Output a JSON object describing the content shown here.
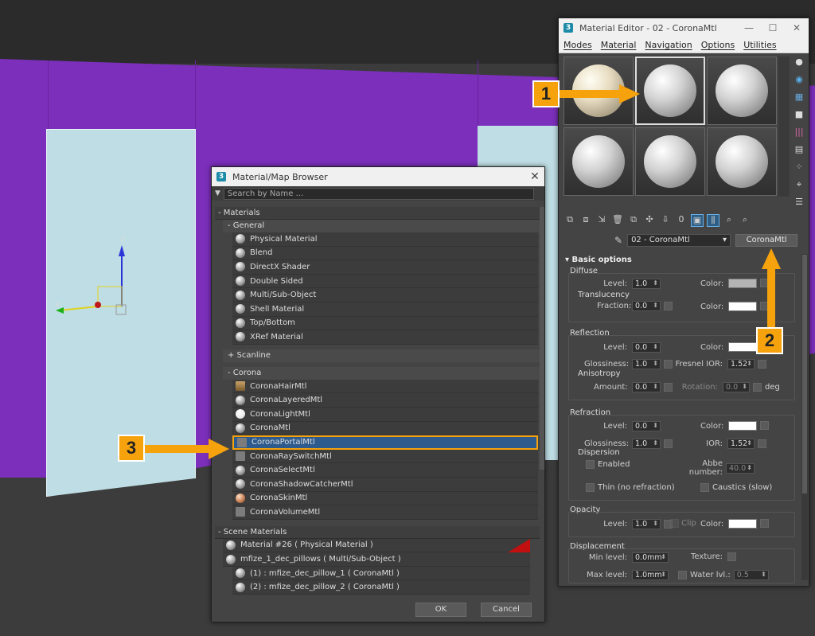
{
  "material_editor": {
    "title": "Material Editor - 02 - CoronaMtl",
    "menu": [
      "Modes",
      "Material",
      "Navigation",
      "Options",
      "Utilities"
    ],
    "material_name": "02 - CoronaMtl",
    "material_type": "CoronaMtl",
    "rollout_title": "Basic options",
    "diffuse": {
      "title": "Diffuse",
      "level_label": "Level:",
      "level": "1.0",
      "color_label": "Color:",
      "color": "#b4b4b4",
      "translucency_title": "Translucency",
      "fraction_label": "Fraction:",
      "fraction": "0.0",
      "trans_color_label": "Color:",
      "trans_color": "#ffffff"
    },
    "reflection": {
      "title": "Reflection",
      "level_label": "Level:",
      "level": "0.0",
      "color_label": "Color:",
      "color": "#ffffff",
      "glossiness_label": "Glossiness:",
      "glossiness": "1.0",
      "ior_label": "Fresnel IOR:",
      "ior": "1.52",
      "anisotropy_title": "Anisotropy",
      "amount_label": "Amount:",
      "amount": "0.0",
      "rotation_label": "Rotation:",
      "rotation": "0.0",
      "rotation_unit": "deg"
    },
    "refraction": {
      "title": "Refraction",
      "level_label": "Level:",
      "level": "0.0",
      "color_label": "Color:",
      "color": "#ffffff",
      "glossiness_label": "Glossiness:",
      "glossiness": "1.0",
      "ior_label": "IOR:",
      "ior": "1.52",
      "dispersion_title": "Dispersion",
      "enabled_label": "Enabled",
      "abbe_label": "Abbe number:",
      "abbe": "40.0",
      "thin_label": "Thin (no refraction)",
      "caustics_label": "Caustics (slow)"
    },
    "opacity": {
      "title": "Opacity",
      "level_label": "Level:",
      "level": "1.0",
      "clip_label": "Clip",
      "color_label": "Color:",
      "color": "#ffffff"
    },
    "displacement": {
      "title": "Displacement",
      "min_label": "Min level:",
      "min": "0.0mm",
      "texture_label": "Texture:",
      "max_label": "Max level:",
      "max": "1.0mm",
      "water_label": "Water lvl.:",
      "water": "0.5"
    }
  },
  "browser": {
    "title": "Material/Map Browser",
    "search_placeholder": "Search by Name ...",
    "materials_header": "- Materials",
    "general_header": "- General",
    "general_items": [
      "Physical Material",
      "Blend",
      "DirectX Shader",
      "Double Sided",
      "Multi/Sub-Object",
      "Shell Material",
      "Top/Bottom",
      "XRef Material"
    ],
    "scanline_header": "+ Scanline",
    "corona_header": "- Corona",
    "corona_items": [
      "CoronaHairMtl",
      "CoronaLayeredMtl",
      "CoronaLightMtl",
      "CoronaMtl",
      "CoronaPortalMtl",
      "CoronaRaySwitchMtl",
      "CoronaSelectMtl",
      "CoronaShadowCatcherMtl",
      "CoronaSkinMtl",
      "CoronaVolumeMtl"
    ],
    "scene_header": "- Scene Materials",
    "scene_items": [
      "Material #26  ( Physical Material )",
      "mfize_1_dec_pillows  ( Multi/Sub-Object )",
      "(1) : mfize_dec_pillow_1  ( CoronaMtl )",
      "(2) : mfize_dec_pillow_2  ( CoronaMtl )"
    ],
    "ok_label": "OK",
    "cancel_label": "Cancel"
  },
  "callouts": {
    "one": "1",
    "two": "2",
    "three": "3",
    "color": "#f5a20d"
  },
  "gizmo": {
    "z_label": "z",
    "x_label": "x"
  }
}
